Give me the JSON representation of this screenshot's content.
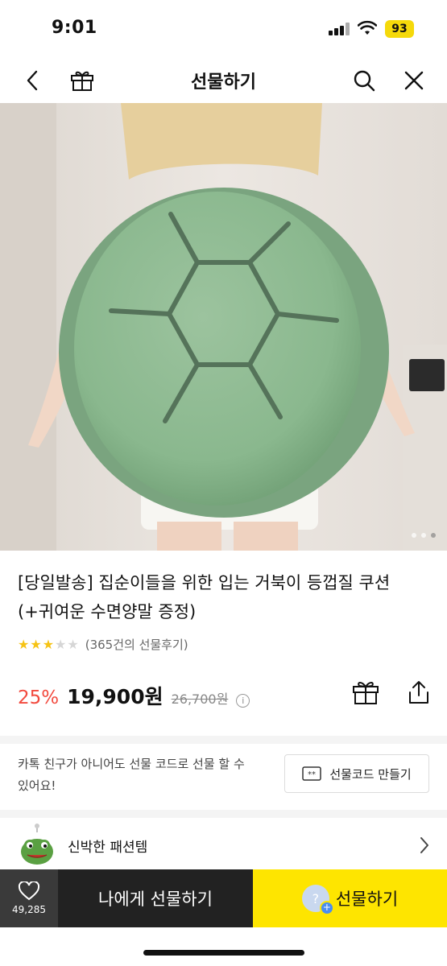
{
  "status": {
    "time": "9:01",
    "battery": "93"
  },
  "nav": {
    "title": "선물하기"
  },
  "product": {
    "title": "[당일발송] 집순이들을 위한 입는 거북이 등껍질 쿠션 (+귀여운 수면양말 증정)",
    "rating": 3,
    "rating_max": 5,
    "review_count": "(365건의 선물후기)",
    "discount": "25%",
    "price": "19,900원",
    "original_price": "26,700원",
    "image_index": 1,
    "image_total": 3
  },
  "giftcode": {
    "description": "카톡 친구가 아니어도 선물 코드로 선물 할 수 있어요!",
    "button_label": "선물코드 만들기"
  },
  "promo": {
    "label": "신박한 패션템"
  },
  "bottom": {
    "like_count": "49,285",
    "self_gift_label": "나에게 선물하기",
    "gift_label": "선물하기",
    "gift_avatar_mark": "?"
  },
  "colors": {
    "accent_yellow": "#fee500",
    "discount_red": "#f24a3e",
    "star_yellow": "#f6c315",
    "dark_button": "#222222"
  }
}
